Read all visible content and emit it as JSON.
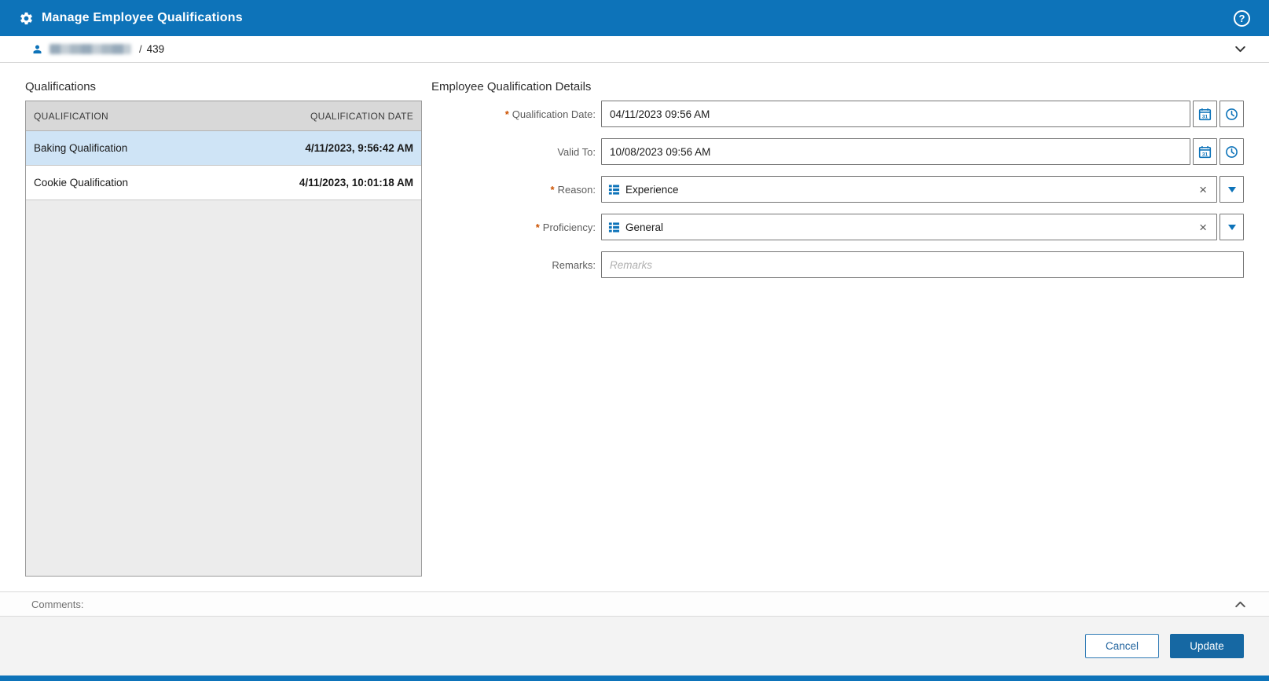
{
  "colors": {
    "header_bg": "#0d73b9",
    "accent": "#0d73b9",
    "selected_row_bg": "#cfe4f6",
    "required_marker_color": "#cc5200",
    "primary_button_bg": "#1668a3"
  },
  "header": {
    "title": "Manage Employee Qualifications",
    "help_glyph": "?"
  },
  "breadcrumb": {
    "separator": "/",
    "employee_id": "439"
  },
  "icons": {
    "clear_glyph": "×"
  },
  "labels": {
    "required_marker": "*"
  },
  "qualifications_panel": {
    "title": "Qualifications",
    "columns": {
      "qualification": "QUALIFICATION",
      "date": "QUALIFICATION DATE"
    },
    "rows": [
      {
        "qualification": "Baking Qualification",
        "date": "4/11/2023, 9:56:42 AM",
        "selected": true
      },
      {
        "qualification": "Cookie Qualification",
        "date": "4/11/2023, 10:01:18 AM",
        "selected": false
      }
    ]
  },
  "details_panel": {
    "title": "Employee Qualification Details",
    "fields": {
      "qualification_date": {
        "label": "Qualification Date:",
        "required": true,
        "value": "04/11/2023 09:56 AM"
      },
      "valid_to": {
        "label": "Valid To:",
        "required": false,
        "value": "10/08/2023 09:56 AM"
      },
      "reason": {
        "label": "Reason:",
        "required": true,
        "value": "Experience"
      },
      "proficiency": {
        "label": "Proficiency:",
        "required": true,
        "value": "General"
      },
      "remarks": {
        "label": "Remarks:",
        "required": false,
        "value": "",
        "placeholder": "Remarks"
      }
    }
  },
  "comments": {
    "label": "Comments:"
  },
  "footer": {
    "cancel_label": "Cancel",
    "update_label": "Update"
  }
}
